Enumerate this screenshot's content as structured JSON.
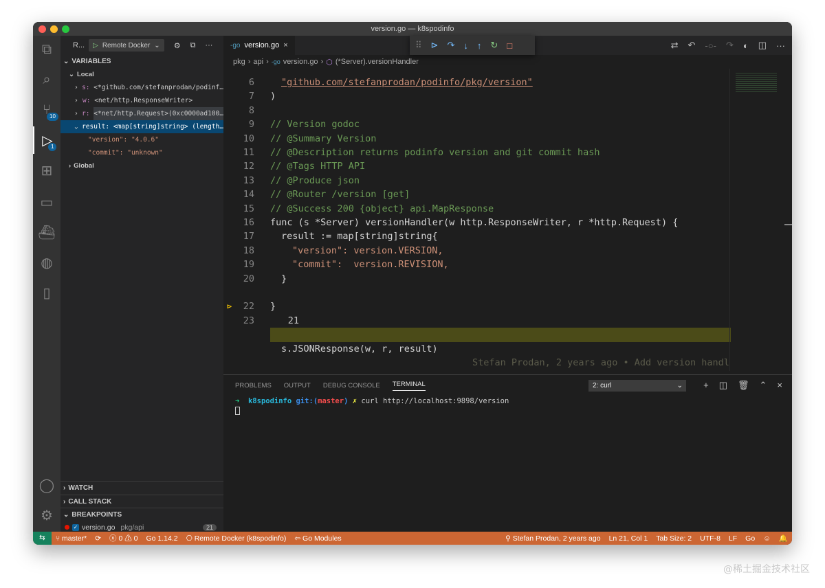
{
  "window": {
    "title": "version.go — k8spodinfo"
  },
  "activity_bar": {
    "scm_badge": "10",
    "debug_badge": "1"
  },
  "sidebar": {
    "view_short": "R...",
    "debug_config": "Remote Docker",
    "variables_header": "VARIABLES",
    "local_header": "Local",
    "variables": [
      {
        "name": "s:",
        "value": "<*github.com/stefanprodan/podinf…"
      },
      {
        "name": "w:",
        "value": "<net/http.ResponseWriter>"
      },
      {
        "name": "r:",
        "value": "<*net/http.Request>(0xc0000ad100…"
      },
      {
        "name": "result:",
        "value": "<map[string]string> (length…"
      }
    ],
    "result_children": [
      {
        "key": "\"version\":",
        "value": "\"4.0.6\""
      },
      {
        "key": "\"commit\":",
        "value": "\"unknown\""
      }
    ],
    "global_header": "Global",
    "watch_header": "WATCH",
    "call_stack_header": "CALL STACK",
    "breakpoints_header": "BREAKPOINTS",
    "breakpoint": {
      "file": "version.go",
      "path": "pkg/api",
      "line": "21"
    }
  },
  "editor": {
    "tab_label": "version.go",
    "breadcrumb": [
      "pkg",
      "api",
      "version.go",
      "(*Server).versionHandler"
    ],
    "lines": [
      {
        "num": "6",
        "text": "\"github.com/stefanprodan/podinfo/pkg/version\""
      },
      {
        "num": "7",
        "text": ")"
      },
      {
        "num": "8",
        "text": ""
      },
      {
        "num": "9",
        "text": "// Version godoc"
      },
      {
        "num": "10",
        "text": "// @Summary Version"
      },
      {
        "num": "11",
        "text": "// @Description returns podinfo version and git commit hash"
      },
      {
        "num": "12",
        "text": "// @Tags HTTP API"
      },
      {
        "num": "13",
        "text": "// @Produce json"
      },
      {
        "num": "14",
        "text": "// @Router /version [get]"
      },
      {
        "num": "15",
        "text": "// @Success 200 {object} api.MapResponse"
      },
      {
        "num": "16",
        "text": "func (s *Server) versionHandler(w http.ResponseWriter, r *http.Request) {"
      },
      {
        "num": "17",
        "text": "result := map[string]string{"
      },
      {
        "num": "18",
        "text": "\"version\": version.VERSION,"
      },
      {
        "num": "19",
        "text": "\"commit\":  version.REVISION,"
      },
      {
        "num": "20",
        "text": "}"
      },
      {
        "num": "21",
        "text": "s.JSONResponse(w, r, result)"
      },
      {
        "num": "22",
        "text": "}"
      },
      {
        "num": "23",
        "text": ""
      }
    ],
    "blame": "Stefan Prodan, 2 years ago • Add version handl"
  },
  "panel": {
    "tabs": [
      "PROBLEMS",
      "OUTPUT",
      "DEBUG CONSOLE",
      "TERMINAL"
    ],
    "active_tab": "TERMINAL",
    "terminal_select": "2: curl",
    "prompt_arrow": "➜",
    "prompt_dir": "k8spodinfo",
    "prompt_git": "git:(",
    "prompt_branch": "master",
    "prompt_git_close": ")",
    "prompt_x": "✗",
    "command": "curl http://localhost:9898/version"
  },
  "statusbar": {
    "branch": "master*",
    "problems": "ⓧ 0 ⚠ 0",
    "go_version": "Go 1.14.2",
    "remote": "Remote Docker (k8spodinfo)",
    "go_modules": "Go Modules",
    "blame": "Stefan Prodan, 2 years ago",
    "position": "Ln 21, Col 1",
    "tab_size": "Tab Size: 2",
    "encoding": "UTF-8",
    "eol": "LF",
    "language": "Go"
  },
  "colors": {
    "statusbar": "#cc6633",
    "activity_bar": "#333333",
    "sidebar": "#252526",
    "editor": "#1e1e1e"
  },
  "watermark": "@稀土掘金技术社区"
}
